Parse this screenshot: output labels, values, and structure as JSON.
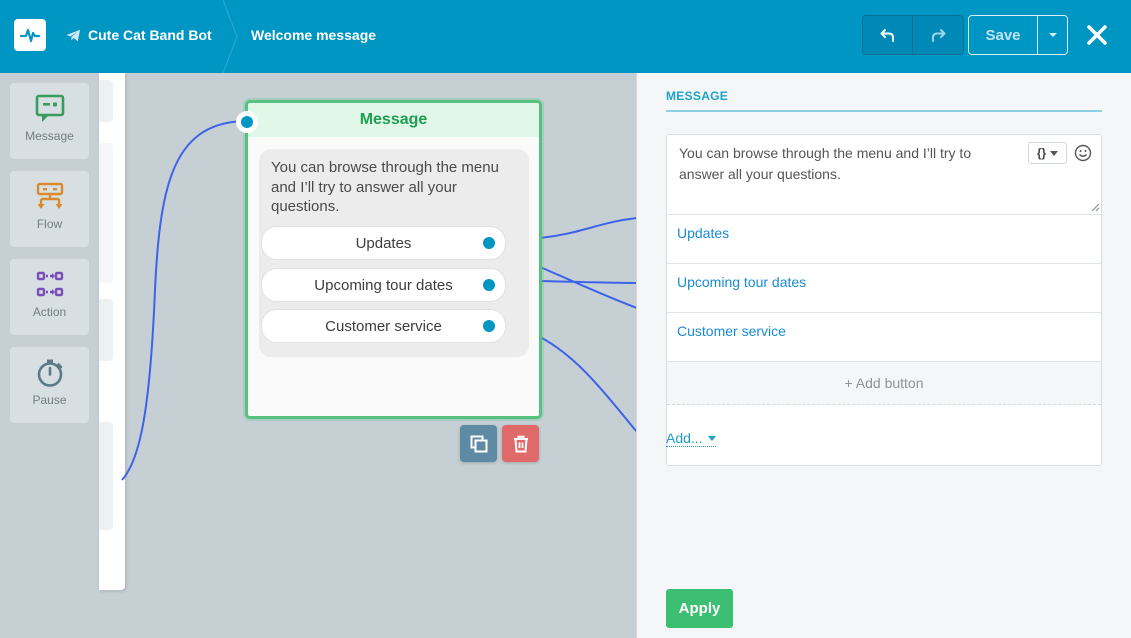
{
  "header": {
    "bot_name": "Cute Cat Band Bot",
    "page_title": "Welcome message",
    "save_label": "Save"
  },
  "palette": {
    "items": [
      {
        "label": "Message",
        "icon": "message-icon"
      },
      {
        "label": "Flow",
        "icon": "flow-icon"
      },
      {
        "label": "Action",
        "icon": "action-icon"
      },
      {
        "label": "Pause",
        "icon": "pause-stopwatch-icon"
      }
    ]
  },
  "node": {
    "title": "Message",
    "text": "You can browse through the menu and I’ll try to answer all your questions.",
    "buttons": [
      "Updates",
      "Upcoming tour dates",
      "Customer service"
    ]
  },
  "panel": {
    "section_title": "MESSAGE",
    "message_text": "You can browse through the menu and I’ll try to answer all your questions.",
    "variable_label": "{}",
    "buttons": [
      "Updates",
      "Upcoming tour dates",
      "Customer service"
    ],
    "add_button_label": "+ Add button",
    "add_more_label": "Add...",
    "apply_label": "Apply"
  },
  "colors": {
    "header": "#0096c4",
    "node_border": "#57c27f",
    "connection": "#3d63e8",
    "apply": "#3cbf72",
    "link": "#1a8ad4"
  }
}
